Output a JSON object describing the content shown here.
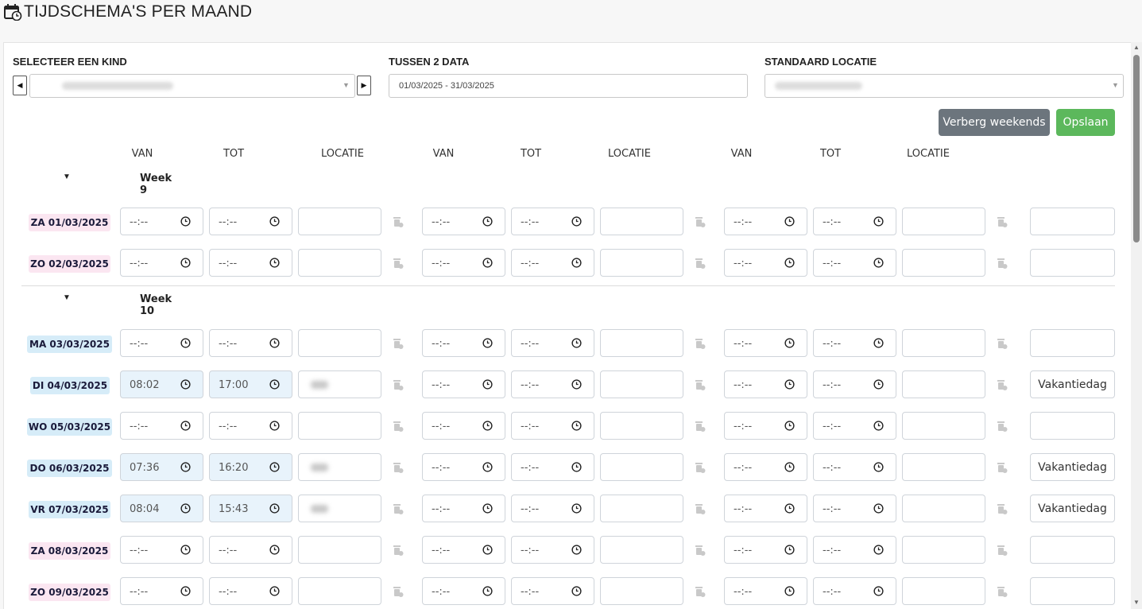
{
  "header": {
    "title": "TIJDSCHEMA'S PER MAAND",
    "icon": "calendar-clock-icon"
  },
  "filters": {
    "child_label": "SELECTEER EEN KIND",
    "range_label": "TUSSEN 2 DATA",
    "range_value": "01/03/2025 - 31/03/2025",
    "location_label": "STANDAARD LOCATIE"
  },
  "buttons": {
    "hide_weekends": "Verberg weekends",
    "save": "Opslaan"
  },
  "columns": [
    "VAN",
    "TOT",
    "LOCATIE",
    "VAN",
    "TOT",
    "LOCATIE",
    "VAN",
    "TOT",
    "LOCATIE"
  ],
  "empty_time": "--:--",
  "weeks": [
    {
      "label": "Week 9",
      "days": [
        {
          "day": "ZA",
          "date": "01/03/2025",
          "weekend": true,
          "van": "",
          "tot": "",
          "location": false,
          "note": ""
        },
        {
          "day": "ZO",
          "date": "02/03/2025",
          "weekend": true,
          "van": "",
          "tot": "",
          "location": false,
          "note": ""
        }
      ]
    },
    {
      "label": "Week 10",
      "days": [
        {
          "day": "MA",
          "date": "03/03/2025",
          "weekend": false,
          "van": "",
          "tot": "",
          "location": false,
          "note": ""
        },
        {
          "day": "DI",
          "date": "04/03/2025",
          "weekend": false,
          "van": "08:02",
          "tot": "17:00",
          "location": true,
          "note": "Vakantiedag"
        },
        {
          "day": "WO",
          "date": "05/03/2025",
          "weekend": false,
          "van": "",
          "tot": "",
          "location": false,
          "note": ""
        },
        {
          "day": "DO",
          "date": "06/03/2025",
          "weekend": false,
          "van": "07:36",
          "tot": "16:20",
          "location": true,
          "note": "Vakantiedag"
        },
        {
          "day": "VR",
          "date": "07/03/2025",
          "weekend": false,
          "van": "08:04",
          "tot": "15:43",
          "location": true,
          "note": "Vakantiedag"
        },
        {
          "day": "ZA",
          "date": "08/03/2025",
          "weekend": true,
          "van": "",
          "tot": "",
          "location": false,
          "note": ""
        },
        {
          "day": "ZO",
          "date": "09/03/2025",
          "weekend": true,
          "van": "",
          "tot": "",
          "location": false,
          "note": ""
        }
      ]
    }
  ],
  "colors": {
    "weekend_badge": "#fbe6f1",
    "weekday_badge": "#d6ecf8",
    "filled_time": "#e8f3fb",
    "save_green": "#5cb85c",
    "hide_gray": "#6c757d"
  }
}
